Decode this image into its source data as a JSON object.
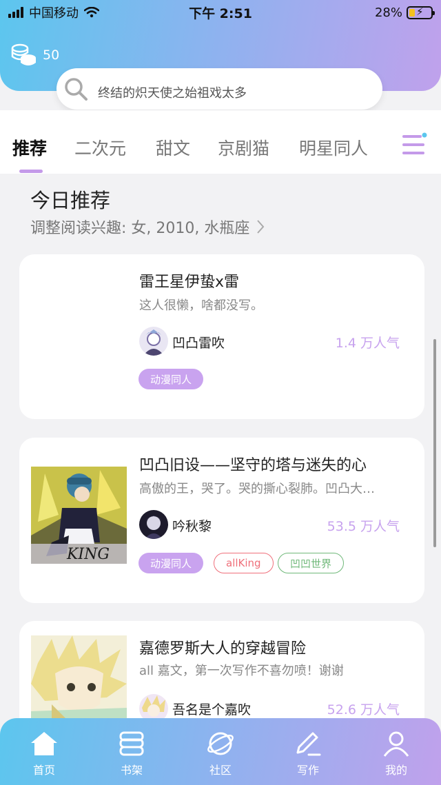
{
  "status_bar": {
    "carrier": "中国移动",
    "time": "下午 2:51",
    "battery": "28%"
  },
  "header": {
    "coin_count": "50",
    "search_placeholder": "终结的炽天使之始祖戏太多"
  },
  "tabs": [
    {
      "label": "推荐",
      "active": true
    },
    {
      "label": "二次元",
      "active": false
    },
    {
      "label": "甜文",
      "active": false
    },
    {
      "label": "京剧猫",
      "active": false
    },
    {
      "label": "明星同人",
      "active": false
    }
  ],
  "section": {
    "title": "今日推荐",
    "subtitle": "调整阅读兴趣: 女, 2010, 水瓶座"
  },
  "books": [
    {
      "title": "雷王星伊蛰x雷",
      "desc": "这人很懒，啥都没写。",
      "author": "凹凸雷吹",
      "popularity": "1.4 万人气",
      "tags": [
        {
          "label": "动漫同人",
          "style": "fill"
        }
      ]
    },
    {
      "title": "凹凸旧设——坚守的塔与迷失的心",
      "desc": "高傲的王，哭了。哭的撕心裂肺。凹凸大…",
      "author": "吟秋黎",
      "popularity": "53.5 万人气",
      "cover_text": "KING",
      "tags": [
        {
          "label": "动漫同人",
          "style": "fill"
        },
        {
          "label": "allKing",
          "style": "red"
        },
        {
          "label": "凹凹世界",
          "style": "green"
        }
      ]
    },
    {
      "title": "嘉德罗斯大人的穿越冒险",
      "desc": "all 嘉文，第一次写作不喜勿喷！谢谢",
      "author": "吾名是个嘉吹",
      "popularity": "52.6 万人气",
      "tags": []
    }
  ],
  "bottom_nav": [
    {
      "label": "首页",
      "icon": "home-icon",
      "active": true
    },
    {
      "label": "书架",
      "icon": "bookshelf-icon",
      "active": false
    },
    {
      "label": "社区",
      "icon": "planet-icon",
      "active": false
    },
    {
      "label": "写作",
      "icon": "pen-icon",
      "active": false
    },
    {
      "label": "我的",
      "icon": "profile-icon",
      "active": false
    }
  ],
  "colors": {
    "gradient_start": "#5cc6ee",
    "gradient_end": "#c0a1ec",
    "accent_purple": "#c9a3ef",
    "popularity": "#c7a2ee"
  }
}
